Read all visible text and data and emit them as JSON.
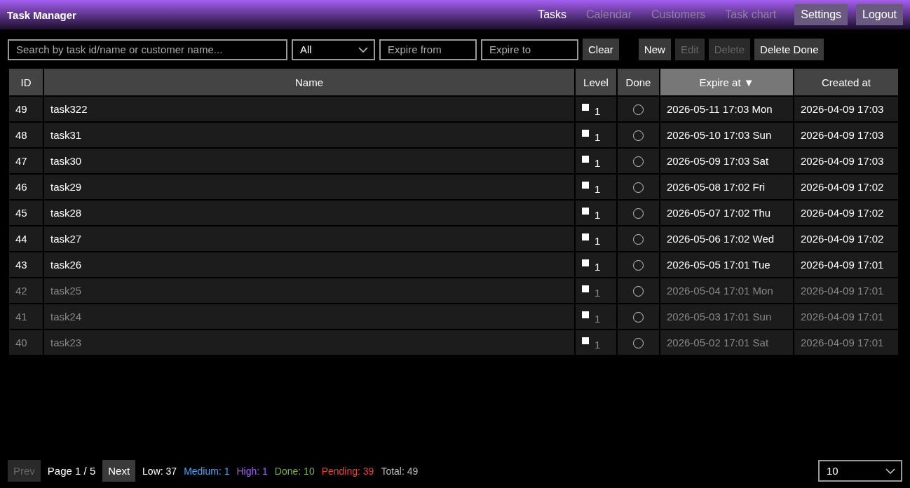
{
  "app_title": "Task Manager",
  "nav": [
    {
      "label": "Tasks",
      "disabled": false
    },
    {
      "label": "Calendar",
      "disabled": true
    },
    {
      "label": "Customers",
      "disabled": true
    },
    {
      "label": "Task chart",
      "disabled": true
    }
  ],
  "header_buttons": [
    "Settings",
    "Logout"
  ],
  "toolbar": {
    "search": {
      "placeholder": "Search by task id/name or customer name..."
    },
    "filter": {
      "value": "All"
    },
    "expire_from": {
      "placeholder": "Expire from"
    },
    "expire_to": {
      "placeholder": "Expire to"
    },
    "filter_buttons": [
      {
        "label": "Clear",
        "disabled": false
      }
    ],
    "action_buttons": [
      {
        "label": "New",
        "disabled": false
      },
      {
        "label": "Edit",
        "disabled": true
      },
      {
        "label": "Delete",
        "disabled": true
      },
      {
        "label": "Delete Done",
        "disabled": false
      }
    ]
  },
  "table": {
    "columns": [
      {
        "label": "ID",
        "sorted": false
      },
      {
        "label": "Name",
        "sorted": false
      },
      {
        "label": "Level",
        "sorted": false
      },
      {
        "label": "Done",
        "sorted": false
      },
      {
        "label": "Expire at",
        "sorted": true,
        "sort_indicator": "▼"
      },
      {
        "label": "Created at",
        "sorted": false
      }
    ],
    "rows": [
      {
        "id": "49",
        "name": "task322",
        "level": "1",
        "done": false,
        "dimmed": false,
        "expire": "2026-05-11 17:03 Mon",
        "created": "2026-04-09 17:03"
      },
      {
        "id": "48",
        "name": "task31",
        "level": "1",
        "done": false,
        "dimmed": false,
        "expire": "2026-05-10 17:03 Sun",
        "created": "2026-04-09 17:03"
      },
      {
        "id": "47",
        "name": "task30",
        "level": "1",
        "done": false,
        "dimmed": false,
        "expire": "2026-05-09 17:03 Sat",
        "created": "2026-04-09 17:03"
      },
      {
        "id": "46",
        "name": "task29",
        "level": "1",
        "done": false,
        "dimmed": false,
        "expire": "2026-05-08 17:02 Fri",
        "created": "2026-04-09 17:02"
      },
      {
        "id": "45",
        "name": "task28",
        "level": "1",
        "done": false,
        "dimmed": false,
        "expire": "2026-05-07 17:02 Thu",
        "created": "2026-04-09 17:02"
      },
      {
        "id": "44",
        "name": "task27",
        "level": "1",
        "done": false,
        "dimmed": false,
        "expire": "2026-05-06 17:02 Wed",
        "created": "2026-04-09 17:02"
      },
      {
        "id": "43",
        "name": "task26",
        "level": "1",
        "done": false,
        "dimmed": false,
        "expire": "2026-05-05 17:01 Tue",
        "created": "2026-04-09 17:01"
      },
      {
        "id": "42",
        "name": "task25",
        "level": "1",
        "done": false,
        "dimmed": true,
        "expire": "2026-05-04 17:01 Mon",
        "created": "2026-04-09 17:01"
      },
      {
        "id": "41",
        "name": "task24",
        "level": "1",
        "done": false,
        "dimmed": true,
        "expire": "2026-05-03 17:01 Sun",
        "created": "2026-04-09 17:01"
      },
      {
        "id": "40",
        "name": "task23",
        "level": "1",
        "done": false,
        "dimmed": true,
        "expire": "2026-05-02 17:01 Sat",
        "created": "2026-04-09 17:01"
      }
    ]
  },
  "pagination": {
    "prev": {
      "label": "Prev",
      "disabled": true
    },
    "page": "Page 1 / 5",
    "next": {
      "label": "Next",
      "disabled": false
    }
  },
  "stats": [
    {
      "text": "Low: 37",
      "color": "#ffffff"
    },
    {
      "text": "Medium: 1",
      "color": "#4aa3f0"
    },
    {
      "text": "High: 1",
      "color": "#a060f0"
    },
    {
      "text": "Done: 10",
      "color": "#7cb342"
    },
    {
      "text": "Pending: 39",
      "color": "#e8453c"
    },
    {
      "text": "Total: 49",
      "color": "#bbbbbb"
    }
  ],
  "page_size": {
    "value": "10"
  }
}
